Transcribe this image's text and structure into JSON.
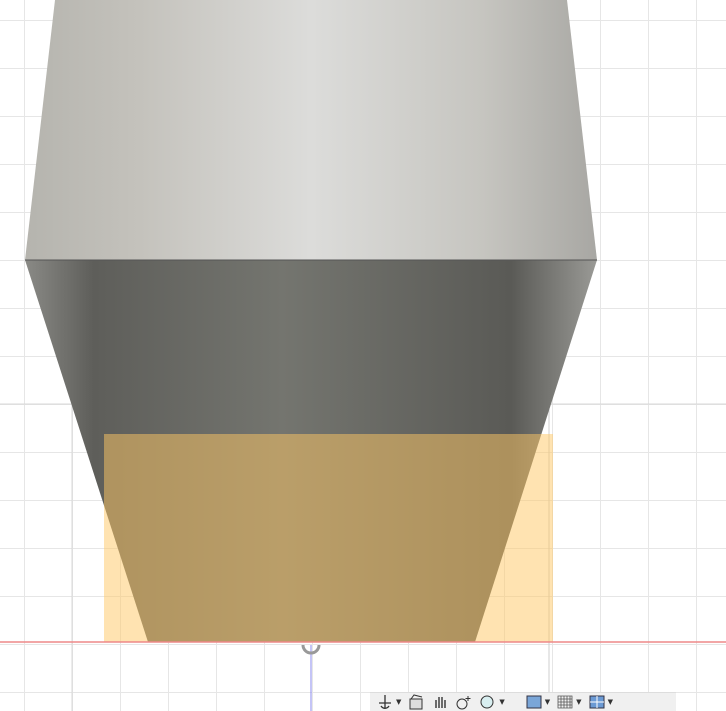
{
  "viewport": {
    "colors": {
      "body_top": "#c9c8c4",
      "body_bottom": "#6a6a66",
      "selection": "#ffc864",
      "x_axis": "#e88",
      "z_axis": "#88f"
    }
  },
  "toolbar": {
    "items": [
      {
        "icon": "orbit-icon",
        "dropdown": true
      },
      {
        "icon": "look-at-icon",
        "dropdown": false
      },
      {
        "icon": "pan-icon",
        "dropdown": false
      },
      {
        "icon": "zoom-icon",
        "dropdown": false
      },
      {
        "icon": "fit-icon",
        "dropdown": true
      },
      {
        "icon": "display-settings-icon",
        "dropdown": true
      },
      {
        "icon": "grid-settings-icon",
        "dropdown": true
      },
      {
        "icon": "viewports-icon",
        "dropdown": true
      }
    ]
  }
}
